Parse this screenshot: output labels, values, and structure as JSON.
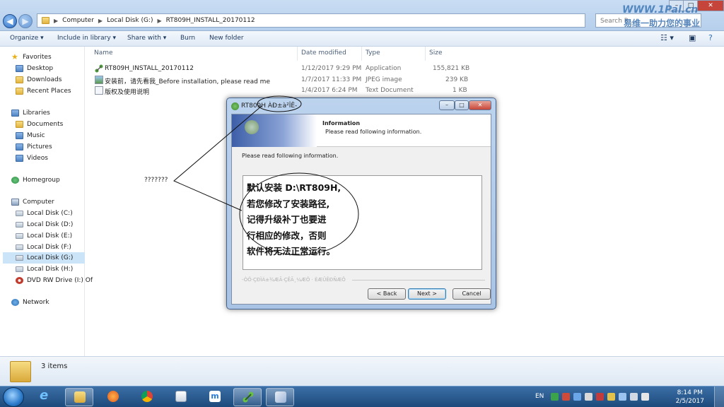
{
  "address_bar": {
    "segments": [
      "Computer",
      "Local Disk (G:)",
      "RT809H_INSTALL_20170112"
    ],
    "search_placeholder": "Search R..."
  },
  "watermark": {
    "line1": "WWW.1Pal.cn",
    "line2": "易维一助力您的事业"
  },
  "toolbar": {
    "organize": "Organize ▾",
    "include_in_library": "Include in library ▾",
    "share_with": "Share with ▾",
    "burn": "Burn",
    "new_folder": "New folder"
  },
  "navigation": {
    "favorites": "Favorites",
    "desktop": "Desktop",
    "downloads": "Downloads",
    "recent_places": "Recent Places",
    "libraries": "Libraries",
    "documents": "Documents",
    "music": "Music",
    "pictures": "Pictures",
    "videos": "Videos",
    "homegroup": "Homegroup",
    "computer": "Computer",
    "local_c": "Local Disk (C:)",
    "local_d": "Local Disk (D:)",
    "local_e": "Local Disk (E:)",
    "local_f": "Local Disk (F:)",
    "local_g": "Local Disk (G:)",
    "local_h": "Local Disk (H:)",
    "dvd": "DVD RW Drive (I:) Of",
    "network": "Network"
  },
  "columns": {
    "name": "Name",
    "date_modified": "Date modified",
    "type": "Type",
    "size": "Size"
  },
  "files": [
    {
      "name": "RT809H_INSTALL_20170112",
      "date": "1/12/2017 9:29 PM",
      "type": "Application",
      "size": "155,821 KB"
    },
    {
      "name": "安装前，请先看我_Before installation, please read me",
      "date": "1/7/2017 11:33 PM",
      "type": "JPEG image",
      "size": "239 KB"
    },
    {
      "name": "版权及使用说明",
      "date": "1/4/2017 6:24 PM",
      "type": "Text Document",
      "size": "1 KB"
    }
  ],
  "details": {
    "item_count": "3 items"
  },
  "dialog": {
    "title": "RT809H ÀÐ±à²ÎÊ-",
    "header_title": "Information",
    "header_subtitle": "Please read following information.",
    "body_label": "Please read following information.",
    "note_lines": [
      "默认安装 D:\\RT809H,",
      "若您修改了安装路径,",
      "记得升级补丁也要进",
      "行相应的修改，否则",
      "软件将无法正常运行。"
    ],
    "footer_brand": "-ÒÖ·ÇÐÏÁ±¾ÆÃ·ÇÊÃ¸¼ÆÔ · ÈÆÛÊÐÑÆÔ",
    "back": "< Back",
    "next": "Next >",
    "cancel": "Cancel"
  },
  "annotation": {
    "label": "???????"
  },
  "taskbar": {
    "lang": "EN",
    "time": "8:14 PM",
    "date": "2/5/2017"
  }
}
